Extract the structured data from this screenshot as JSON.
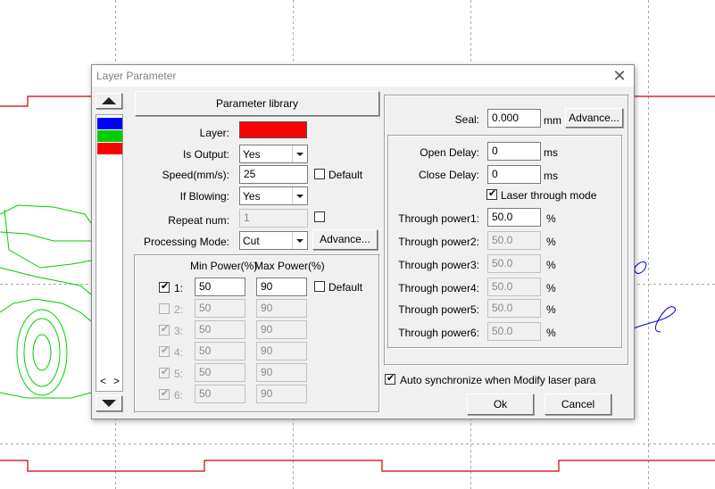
{
  "dialog": {
    "title": "Layer Parameter",
    "parameter_library_label": "Parameter library",
    "layer_label": "Layer:",
    "is_output_label": "Is Output:",
    "is_output_value": "Yes",
    "speed_label": "Speed(mm/s):",
    "speed_value": "25",
    "default_label": "Default",
    "if_blowing_label": "If Blowing:",
    "if_blowing_value": "Yes",
    "repeat_label": "Repeat num:",
    "repeat_value": "1",
    "processing_mode_label": "Processing Mode:",
    "processing_mode_value": "Cut",
    "advance_label": "Advance...",
    "power": {
      "min_header": "Min Power(%)",
      "max_header": "Max Power(%)",
      "default_label": "Default",
      "rows": [
        {
          "label": "1:",
          "min": "50",
          "max": "90",
          "checked": true,
          "enabled": true
        },
        {
          "label": "2:",
          "min": "50",
          "max": "90",
          "checked": false,
          "enabled": false
        },
        {
          "label": "3:",
          "min": "50",
          "max": "90",
          "checked": true,
          "enabled": false
        },
        {
          "label": "4:",
          "min": "50",
          "max": "90",
          "checked": true,
          "enabled": false
        },
        {
          "label": "5:",
          "min": "50",
          "max": "90",
          "checked": true,
          "enabled": false
        },
        {
          "label": "6:",
          "min": "50",
          "max": "90",
          "checked": true,
          "enabled": false
        }
      ]
    },
    "seal_label": "Seal:",
    "seal_value": "0.000",
    "seal_unit": "mm",
    "seal_advance_label": "Advance...",
    "open_delay_label": "Open Delay:",
    "open_delay_value": "0",
    "close_delay_label": "Close Delay:",
    "close_delay_value": "0",
    "delay_unit": "ms",
    "laser_through_label": "Laser through mode",
    "through": [
      {
        "label": "Through power1:",
        "value": "50.0",
        "enabled": true
      },
      {
        "label": "Through power2:",
        "value": "50.0",
        "enabled": false
      },
      {
        "label": "Through power3:",
        "value": "50.0",
        "enabled": false
      },
      {
        "label": "Through power4:",
        "value": "50.0",
        "enabled": false
      },
      {
        "label": "Through power5:",
        "value": "50.0",
        "enabled": false
      },
      {
        "label": "Through power6:",
        "value": "50.0",
        "enabled": false
      }
    ],
    "percent_unit": "%",
    "auto_sync_label": "Auto synchronize when Modify laser para",
    "ok_label": "Ok",
    "cancel_label": "Cancel"
  },
  "colors": {
    "layer_color": "#ff0000",
    "layers": [
      "#0000ff",
      "#00cc00",
      "#ff0000"
    ],
    "canvas_outline": "#cc0000",
    "drawing_green": "#00cc00",
    "drawing_blue": "#0000cc"
  },
  "icons": {
    "close": "close-icon",
    "scroll_up": "arrow-up-icon",
    "scroll_down": "arrow-down-icon",
    "left": "chevron-left-icon",
    "right": "chevron-right-icon"
  }
}
